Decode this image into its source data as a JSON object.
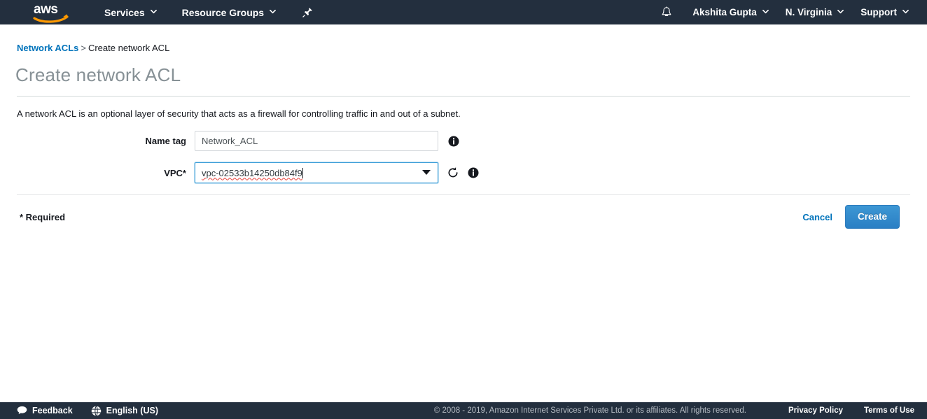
{
  "topnav": {
    "logo_alt": "aws",
    "services_label": "Services",
    "resource_groups_label": "Resource Groups",
    "pin_icon": "pin-icon",
    "bell_icon": "bell-icon",
    "account_label": "Akshita Gupta",
    "region_label": "N. Virginia",
    "support_label": "Support"
  },
  "breadcrumb": {
    "parent": "Network ACLs",
    "separator": ">",
    "current": "Create network ACL"
  },
  "page": {
    "title": "Create network ACL",
    "intro": "A network ACL is an optional layer of security that acts as a firewall for controlling traffic in and out of a subnet."
  },
  "form": {
    "name_tag": {
      "label": "Name tag",
      "value": "Network_ACL",
      "placeholder": "",
      "info_icon": "info-icon"
    },
    "vpc": {
      "label": "VPC*",
      "value": "vpc-02533b14250db84f9",
      "dropdown_icon": "chevron-down-icon",
      "refresh_icon": "refresh-icon",
      "info_icon": "info-icon"
    },
    "required_note": "* Required",
    "cancel_label": "Cancel",
    "create_label": "Create"
  },
  "bottombar": {
    "feedback_label": "Feedback",
    "feedback_icon": "speech-bubble-icon",
    "language_label": "English (US)",
    "language_icon": "globe-icon",
    "copyright": "© 2008 - 2019, Amazon Internet Services Private Ltd. or its affiliates. All rights reserved.",
    "privacy_label": "Privacy Policy",
    "terms_label": "Terms of Use"
  },
  "colors": {
    "nav_bg": "#232f3e",
    "link_blue": "#0073bb",
    "button_blue": "#2a7fc4",
    "title_gray": "#879196",
    "focus_blue": "#3b9dd8",
    "spellcheck_red": "#e8413a",
    "logo_orange": "#ff9900"
  }
}
